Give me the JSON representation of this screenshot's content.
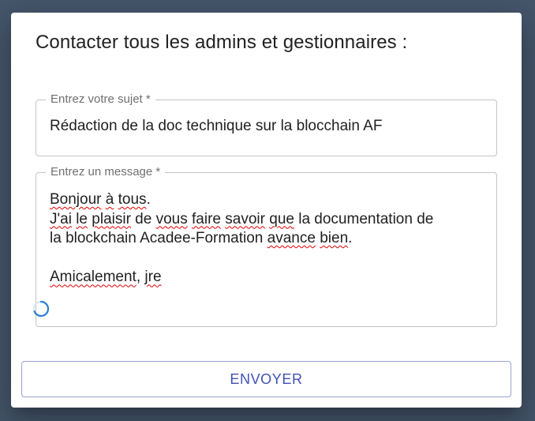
{
  "dialog": {
    "title": "Contacter tous les admins et gestionnaires :"
  },
  "subject": {
    "label": "Entrez votre sujet *",
    "value": "Rédaction de la doc technique sur la blocchain AF"
  },
  "message": {
    "label": "Entrez un message *",
    "lines": [
      "Bonjour à tous.",
      "J'ai le plaisir de vous faire savoir que la documentation de",
      "la blockchain Acadee-Formation avance bien.",
      "",
      "Amicalement, jre"
    ]
  },
  "actions": {
    "send_label": "ENVOYER"
  },
  "icons": {
    "loading": "loading-spinner-icon"
  },
  "colors": {
    "accent": "#3f51b5",
    "spinner": "#2f80d1",
    "spellcheck": "#e00000",
    "backdrop": "#45556b"
  }
}
